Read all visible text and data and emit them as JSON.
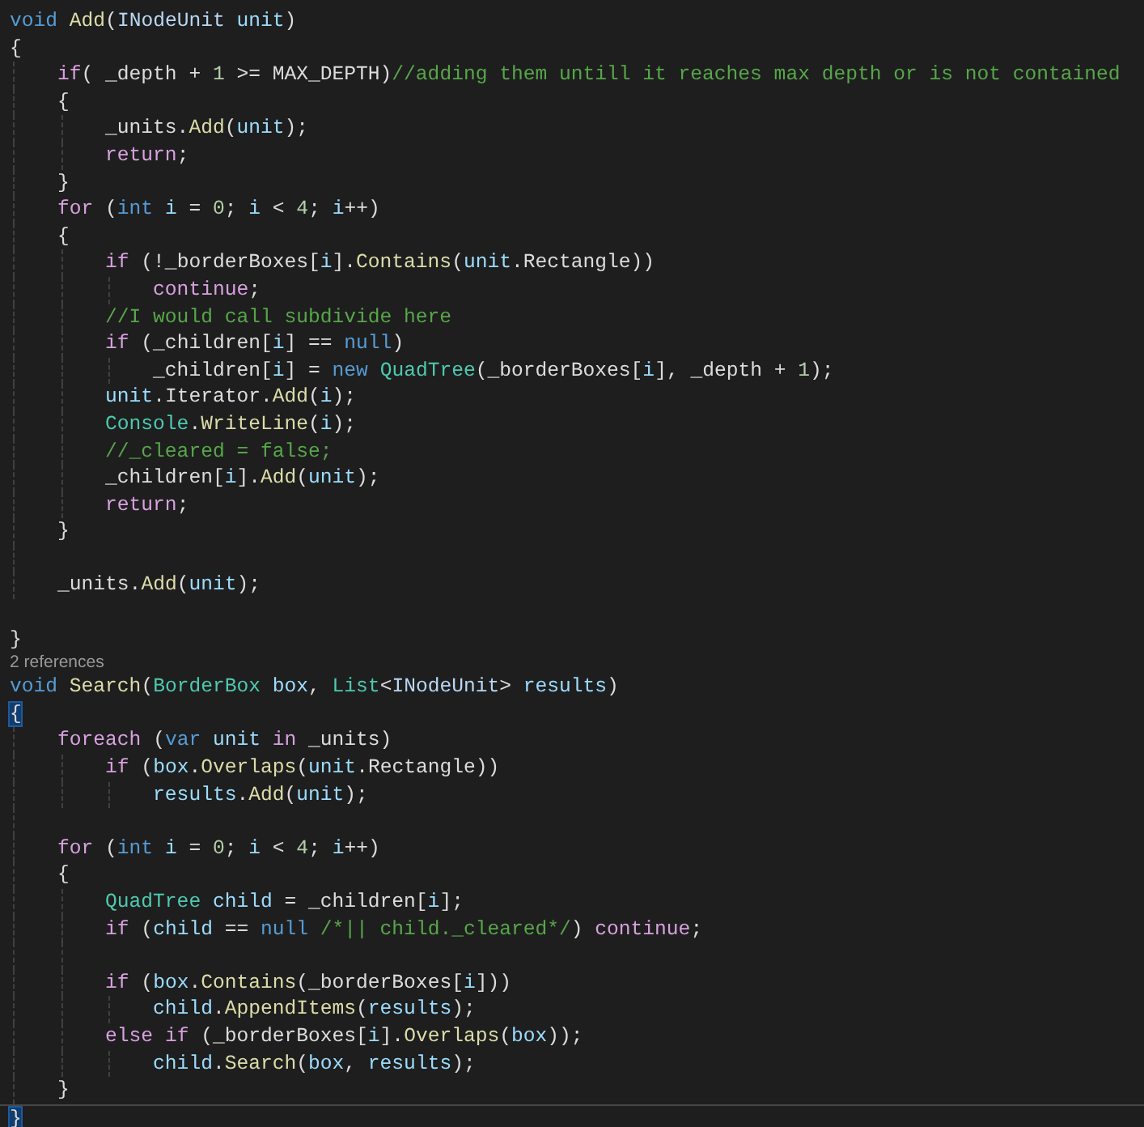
{
  "editor": {
    "lines": [
      {
        "kind": "code",
        "current": false,
        "tokens": [
          {
            "text": "void ",
            "kind": "keyword"
          },
          {
            "text": "Add",
            "kind": "method"
          },
          {
            "text": "(",
            "kind": "plain"
          },
          {
            "text": "INodeUnit ",
            "kind": "interface"
          },
          {
            "text": "unit",
            "kind": "variable"
          },
          {
            "text": ")",
            "kind": "plain"
          }
        ]
      },
      {
        "kind": "code",
        "current": false,
        "tokens": [
          {
            "text": "{",
            "kind": "plain"
          }
        ]
      },
      {
        "kind": "code",
        "current": false,
        "tokens": [
          {
            "text": "    if",
            "kind": "control"
          },
          {
            "text": "( _depth + ",
            "kind": "plain"
          },
          {
            "text": "1",
            "kind": "number"
          },
          {
            "text": " >= MAX_DEPTH)",
            "kind": "plain"
          },
          {
            "text": "//adding them untill it reaches max depth or is not contained",
            "kind": "comment"
          }
        ]
      },
      {
        "kind": "code",
        "current": false,
        "tokens": [
          {
            "text": "    {",
            "kind": "plain"
          }
        ]
      },
      {
        "kind": "code",
        "current": false,
        "tokens": [
          {
            "text": "        _units.",
            "kind": "plain"
          },
          {
            "text": "Add",
            "kind": "method"
          },
          {
            "text": "(",
            "kind": "plain"
          },
          {
            "text": "unit",
            "kind": "variable"
          },
          {
            "text": ");",
            "kind": "plain"
          }
        ]
      },
      {
        "kind": "code",
        "current": false,
        "tokens": [
          {
            "text": "        return",
            "kind": "control"
          },
          {
            "text": ";",
            "kind": "plain"
          }
        ]
      },
      {
        "kind": "code",
        "current": false,
        "tokens": [
          {
            "text": "    }",
            "kind": "plain"
          }
        ]
      },
      {
        "kind": "code",
        "current": false,
        "tokens": [
          {
            "text": "    for",
            "kind": "control"
          },
          {
            "text": " (",
            "kind": "plain"
          },
          {
            "text": "int ",
            "kind": "keyword"
          },
          {
            "text": "i",
            "kind": "variable"
          },
          {
            "text": " = ",
            "kind": "plain"
          },
          {
            "text": "0",
            "kind": "number"
          },
          {
            "text": "; ",
            "kind": "plain"
          },
          {
            "text": "i",
            "kind": "variable"
          },
          {
            "text": " < ",
            "kind": "plain"
          },
          {
            "text": "4",
            "kind": "number"
          },
          {
            "text": "; ",
            "kind": "plain"
          },
          {
            "text": "i",
            "kind": "variable"
          },
          {
            "text": "++)",
            "kind": "plain"
          }
        ]
      },
      {
        "kind": "code",
        "current": false,
        "tokens": [
          {
            "text": "    {",
            "kind": "plain"
          }
        ]
      },
      {
        "kind": "code",
        "current": false,
        "tokens": [
          {
            "text": "        if",
            "kind": "control"
          },
          {
            "text": " (!_borderBoxes[",
            "kind": "plain"
          },
          {
            "text": "i",
            "kind": "variable"
          },
          {
            "text": "].",
            "kind": "plain"
          },
          {
            "text": "Contains",
            "kind": "method"
          },
          {
            "text": "(",
            "kind": "plain"
          },
          {
            "text": "unit",
            "kind": "variable"
          },
          {
            "text": ".Rectangle))",
            "kind": "plain"
          }
        ]
      },
      {
        "kind": "code",
        "current": false,
        "tokens": [
          {
            "text": "            continue",
            "kind": "control"
          },
          {
            "text": ";",
            "kind": "plain"
          }
        ]
      },
      {
        "kind": "code",
        "current": false,
        "tokens": [
          {
            "text": "        //I would call subdivide here",
            "kind": "comment"
          }
        ]
      },
      {
        "kind": "code",
        "current": false,
        "tokens": [
          {
            "text": "        if",
            "kind": "control"
          },
          {
            "text": " (_children[",
            "kind": "plain"
          },
          {
            "text": "i",
            "kind": "variable"
          },
          {
            "text": "] == ",
            "kind": "plain"
          },
          {
            "text": "null",
            "kind": "keyword"
          },
          {
            "text": ")",
            "kind": "plain"
          }
        ]
      },
      {
        "kind": "code",
        "current": false,
        "tokens": [
          {
            "text": "            _children[",
            "kind": "plain"
          },
          {
            "text": "i",
            "kind": "variable"
          },
          {
            "text": "] = ",
            "kind": "plain"
          },
          {
            "text": "new ",
            "kind": "keyword"
          },
          {
            "text": "QuadTree",
            "kind": "type"
          },
          {
            "text": "(_borderBoxes[",
            "kind": "plain"
          },
          {
            "text": "i",
            "kind": "variable"
          },
          {
            "text": "], _depth + ",
            "kind": "plain"
          },
          {
            "text": "1",
            "kind": "number"
          },
          {
            "text": ");",
            "kind": "plain"
          }
        ]
      },
      {
        "kind": "code",
        "current": false,
        "tokens": [
          {
            "text": "        unit",
            "kind": "variable"
          },
          {
            "text": ".Iterator.",
            "kind": "plain"
          },
          {
            "text": "Add",
            "kind": "method"
          },
          {
            "text": "(",
            "kind": "plain"
          },
          {
            "text": "i",
            "kind": "variable"
          },
          {
            "text": ");",
            "kind": "plain"
          }
        ]
      },
      {
        "kind": "code",
        "current": false,
        "tokens": [
          {
            "text": "        Console",
            "kind": "type"
          },
          {
            "text": ".",
            "kind": "plain"
          },
          {
            "text": "WriteLine",
            "kind": "method"
          },
          {
            "text": "(",
            "kind": "plain"
          },
          {
            "text": "i",
            "kind": "variable"
          },
          {
            "text": ");",
            "kind": "plain"
          }
        ]
      },
      {
        "kind": "code",
        "current": false,
        "tokens": [
          {
            "text": "        //_cleared = false;",
            "kind": "comment"
          }
        ]
      },
      {
        "kind": "code",
        "current": false,
        "tokens": [
          {
            "text": "        _children[",
            "kind": "plain"
          },
          {
            "text": "i",
            "kind": "variable"
          },
          {
            "text": "].",
            "kind": "plain"
          },
          {
            "text": "Add",
            "kind": "method"
          },
          {
            "text": "(",
            "kind": "plain"
          },
          {
            "text": "unit",
            "kind": "variable"
          },
          {
            "text": ");",
            "kind": "plain"
          }
        ]
      },
      {
        "kind": "code",
        "current": false,
        "tokens": [
          {
            "text": "        return",
            "kind": "control"
          },
          {
            "text": ";",
            "kind": "plain"
          }
        ]
      },
      {
        "kind": "code",
        "current": false,
        "tokens": [
          {
            "text": "    }",
            "kind": "plain"
          }
        ]
      },
      {
        "kind": "blank"
      },
      {
        "kind": "code",
        "current": false,
        "tokens": [
          {
            "text": "    _units.",
            "kind": "plain"
          },
          {
            "text": "Add",
            "kind": "method"
          },
          {
            "text": "(",
            "kind": "plain"
          },
          {
            "text": "unit",
            "kind": "variable"
          },
          {
            "text": ");",
            "kind": "plain"
          }
        ]
      },
      {
        "kind": "blank"
      },
      {
        "kind": "code",
        "current": false,
        "tokens": [
          {
            "text": "}",
            "kind": "plain"
          }
        ]
      },
      {
        "kind": "codelens",
        "text": "2 references"
      },
      {
        "kind": "code",
        "current": false,
        "tokens": [
          {
            "text": "void ",
            "kind": "keyword"
          },
          {
            "text": "Search",
            "kind": "method"
          },
          {
            "text": "(",
            "kind": "plain"
          },
          {
            "text": "BorderBox ",
            "kind": "type"
          },
          {
            "text": "box",
            "kind": "variable"
          },
          {
            "text": ", ",
            "kind": "plain"
          },
          {
            "text": "List",
            "kind": "type"
          },
          {
            "text": "<",
            "kind": "plain"
          },
          {
            "text": "INodeUnit",
            "kind": "interface"
          },
          {
            "text": "> ",
            "kind": "plain"
          },
          {
            "text": "results",
            "kind": "variable"
          },
          {
            "text": ")",
            "kind": "plain"
          }
        ]
      },
      {
        "kind": "code",
        "current": false,
        "tokens": [
          {
            "text": "{",
            "kind": "plain",
            "matched": true
          }
        ]
      },
      {
        "kind": "code",
        "current": false,
        "tokens": [
          {
            "text": "    foreach",
            "kind": "control"
          },
          {
            "text": " (",
            "kind": "plain"
          },
          {
            "text": "var ",
            "kind": "keyword"
          },
          {
            "text": "unit ",
            "kind": "variable"
          },
          {
            "text": "in",
            "kind": "control"
          },
          {
            "text": " _units)",
            "kind": "plain"
          }
        ]
      },
      {
        "kind": "code",
        "current": false,
        "tokens": [
          {
            "text": "        if",
            "kind": "control"
          },
          {
            "text": " (",
            "kind": "plain"
          },
          {
            "text": "box",
            "kind": "variable"
          },
          {
            "text": ".",
            "kind": "plain"
          },
          {
            "text": "Overlaps",
            "kind": "method"
          },
          {
            "text": "(",
            "kind": "plain"
          },
          {
            "text": "unit",
            "kind": "variable"
          },
          {
            "text": ".Rectangle))",
            "kind": "plain"
          }
        ]
      },
      {
        "kind": "code",
        "current": false,
        "tokens": [
          {
            "text": "            results",
            "kind": "variable"
          },
          {
            "text": ".",
            "kind": "plain"
          },
          {
            "text": "Add",
            "kind": "method"
          },
          {
            "text": "(",
            "kind": "plain"
          },
          {
            "text": "unit",
            "kind": "variable"
          },
          {
            "text": ");",
            "kind": "plain"
          }
        ]
      },
      {
        "kind": "blank"
      },
      {
        "kind": "code",
        "current": false,
        "tokens": [
          {
            "text": "    for",
            "kind": "control"
          },
          {
            "text": " (",
            "kind": "plain"
          },
          {
            "text": "int ",
            "kind": "keyword"
          },
          {
            "text": "i",
            "kind": "variable"
          },
          {
            "text": " = ",
            "kind": "plain"
          },
          {
            "text": "0",
            "kind": "number"
          },
          {
            "text": "; ",
            "kind": "plain"
          },
          {
            "text": "i",
            "kind": "variable"
          },
          {
            "text": " < ",
            "kind": "plain"
          },
          {
            "text": "4",
            "kind": "number"
          },
          {
            "text": "; ",
            "kind": "plain"
          },
          {
            "text": "i",
            "kind": "variable"
          },
          {
            "text": "++)",
            "kind": "plain"
          }
        ]
      },
      {
        "kind": "code",
        "current": false,
        "tokens": [
          {
            "text": "    {",
            "kind": "plain"
          }
        ]
      },
      {
        "kind": "code",
        "current": false,
        "tokens": [
          {
            "text": "        QuadTree ",
            "kind": "type"
          },
          {
            "text": "child",
            "kind": "variable"
          },
          {
            "text": " = _children[",
            "kind": "plain"
          },
          {
            "text": "i",
            "kind": "variable"
          },
          {
            "text": "];",
            "kind": "plain"
          }
        ]
      },
      {
        "kind": "code",
        "current": false,
        "tokens": [
          {
            "text": "        if",
            "kind": "control"
          },
          {
            "text": " (",
            "kind": "plain"
          },
          {
            "text": "child",
            "kind": "variable"
          },
          {
            "text": " == ",
            "kind": "plain"
          },
          {
            "text": "null ",
            "kind": "keyword"
          },
          {
            "text": "/*|| child._cleared*/",
            "kind": "comment"
          },
          {
            "text": ") ",
            "kind": "plain"
          },
          {
            "text": "continue",
            "kind": "control"
          },
          {
            "text": ";",
            "kind": "plain"
          }
        ]
      },
      {
        "kind": "blank"
      },
      {
        "kind": "code",
        "current": false,
        "tokens": [
          {
            "text": "        if",
            "kind": "control"
          },
          {
            "text": " (",
            "kind": "plain"
          },
          {
            "text": "box",
            "kind": "variable"
          },
          {
            "text": ".",
            "kind": "plain"
          },
          {
            "text": "Contains",
            "kind": "method"
          },
          {
            "text": "(_borderBoxes[",
            "kind": "plain"
          },
          {
            "text": "i",
            "kind": "variable"
          },
          {
            "text": "]))",
            "kind": "plain"
          }
        ]
      },
      {
        "kind": "code",
        "current": false,
        "tokens": [
          {
            "text": "            child",
            "kind": "variable"
          },
          {
            "text": ".",
            "kind": "plain"
          },
          {
            "text": "AppendItems",
            "kind": "method"
          },
          {
            "text": "(",
            "kind": "plain"
          },
          {
            "text": "results",
            "kind": "variable"
          },
          {
            "text": ");",
            "kind": "plain"
          }
        ]
      },
      {
        "kind": "code",
        "current": false,
        "tokens": [
          {
            "text": "        else ",
            "kind": "control"
          },
          {
            "text": "if",
            "kind": "control"
          },
          {
            "text": " (_borderBoxes[",
            "kind": "plain"
          },
          {
            "text": "i",
            "kind": "variable"
          },
          {
            "text": "].",
            "kind": "plain"
          },
          {
            "text": "Overlaps",
            "kind": "method"
          },
          {
            "text": "(",
            "kind": "plain"
          },
          {
            "text": "box",
            "kind": "variable"
          },
          {
            "text": "));",
            "kind": "plain"
          }
        ]
      },
      {
        "kind": "code",
        "current": false,
        "tokens": [
          {
            "text": "            child",
            "kind": "variable"
          },
          {
            "text": ".",
            "kind": "plain"
          },
          {
            "text": "Search",
            "kind": "method"
          },
          {
            "text": "(",
            "kind": "plain"
          },
          {
            "text": "box",
            "kind": "variable"
          },
          {
            "text": ", ",
            "kind": "plain"
          },
          {
            "text": "results",
            "kind": "variable"
          },
          {
            "text": ");",
            "kind": "plain"
          }
        ]
      },
      {
        "kind": "code",
        "current": false,
        "tokens": [
          {
            "text": "    }",
            "kind": "plain"
          }
        ]
      },
      {
        "kind": "code",
        "current": true,
        "tokens": [
          {
            "text": "}",
            "kind": "plain",
            "matched": true
          }
        ]
      }
    ]
  }
}
